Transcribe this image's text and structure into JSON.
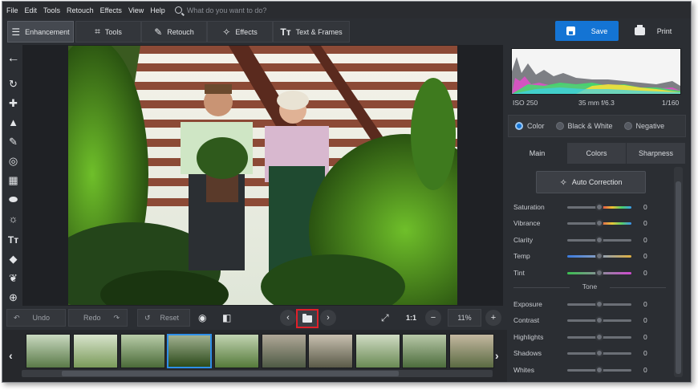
{
  "menu": {
    "items": [
      "File",
      "Edit",
      "Tools",
      "Retouch",
      "Effects",
      "View",
      "Help"
    ],
    "search_placeholder": "What do you want to do?"
  },
  "toolbar": {
    "tabs": [
      {
        "label": "Enhancement",
        "icon": "sliders-icon",
        "active": true
      },
      {
        "label": "Tools",
        "icon": "crop-icon",
        "active": false
      },
      {
        "label": "Retouch",
        "icon": "brush-icon",
        "active": false
      },
      {
        "label": "Effects",
        "icon": "magic-wand-icon",
        "active": false
      },
      {
        "label": "Text & Frames",
        "icon": "text-icon",
        "active": false
      }
    ],
    "save_label": "Save",
    "print_label": "Print",
    "save_color": "#1474d4"
  },
  "left_tools": [
    "back-arrow-icon",
    "rotate-icon",
    "healing-icon",
    "stamp-icon",
    "brush-icon",
    "radial-icon",
    "gradient-icon",
    "vignette-icon",
    "light-icon",
    "text-icon",
    "fill-icon",
    "retouch-icon",
    "target-icon"
  ],
  "bottom_bar": {
    "undo_label": "Undo",
    "redo_label": "Redo",
    "reset_label": "Reset",
    "one_to_one": "1:1",
    "zoom": "11%"
  },
  "filmstrip": {
    "count": 11,
    "selected_index": 3
  },
  "histogram": {
    "iso": "ISO 250",
    "lens": "35 mm f/6.3",
    "shutter": "1/160"
  },
  "color_modes": [
    {
      "label": "Color",
      "selected": true
    },
    {
      "label": "Black & White",
      "selected": false
    },
    {
      "label": "Negative",
      "selected": false
    }
  ],
  "panel_tabs": [
    {
      "label": "Main",
      "active": true
    },
    {
      "label": "Colors",
      "active": false
    },
    {
      "label": "Sharpness",
      "active": false
    }
  ],
  "auto_correction_label": "Auto Correction",
  "sliders_main": [
    {
      "label": "Saturation",
      "value": "0"
    },
    {
      "label": "Vibrance",
      "value": "0"
    },
    {
      "label": "Clarity",
      "value": "0"
    },
    {
      "label": "Temp",
      "value": "0"
    },
    {
      "label": "Tint",
      "value": "0"
    }
  ],
  "tone_header": "Tone",
  "sliders_tone": [
    {
      "label": "Exposure",
      "value": "0"
    },
    {
      "label": "Contrast",
      "value": "0"
    },
    {
      "label": "Highlights",
      "value": "0"
    },
    {
      "label": "Shadows",
      "value": "0"
    },
    {
      "label": "Whites",
      "value": "0"
    }
  ]
}
